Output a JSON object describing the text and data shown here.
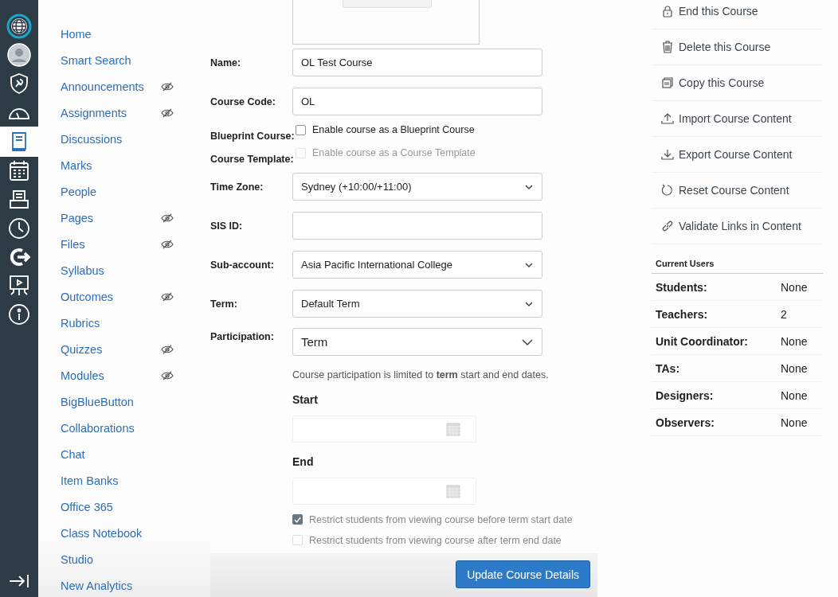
{
  "global_nav": {
    "items": [
      {
        "kind": "logo",
        "selected": false
      },
      {
        "kind": "account",
        "selected": false
      },
      {
        "kind": "admin",
        "selected": false
      },
      {
        "kind": "dashboard",
        "selected": false
      },
      {
        "kind": "courses",
        "selected": true
      },
      {
        "kind": "calendar",
        "selected": false
      },
      {
        "kind": "inbox",
        "selected": false
      },
      {
        "kind": "history",
        "selected": false
      },
      {
        "kind": "commons",
        "selected": false
      },
      {
        "kind": "studio",
        "selected": false
      },
      {
        "kind": "help",
        "selected": false
      }
    ]
  },
  "course_nav": {
    "items": [
      {
        "label": "Home",
        "hidden": false
      },
      {
        "label": "Smart Search",
        "hidden": false
      },
      {
        "label": "Announcements",
        "hidden": true
      },
      {
        "label": "Assignments",
        "hidden": true
      },
      {
        "label": "Discussions",
        "hidden": false
      },
      {
        "label": "Marks",
        "hidden": false
      },
      {
        "label": "People",
        "hidden": false
      },
      {
        "label": "Pages",
        "hidden": true
      },
      {
        "label": "Files",
        "hidden": true
      },
      {
        "label": "Syllabus",
        "hidden": false
      },
      {
        "label": "Outcomes",
        "hidden": true
      },
      {
        "label": "Rubrics",
        "hidden": false
      },
      {
        "label": "Quizzes",
        "hidden": true
      },
      {
        "label": "Modules",
        "hidden": true
      },
      {
        "label": "BigBlueButton",
        "hidden": false
      },
      {
        "label": "Collaborations",
        "hidden": false
      },
      {
        "label": "Chat",
        "hidden": false
      },
      {
        "label": "Item Banks",
        "hidden": false
      },
      {
        "label": "Office 365",
        "hidden": false
      },
      {
        "label": "Class Notebook",
        "hidden": false
      },
      {
        "label": "Studio",
        "hidden": false
      },
      {
        "label": "New Analytics",
        "hidden": false
      }
    ]
  },
  "form": {
    "rows": [
      {
        "kind": "text",
        "label": "Name:",
        "value": "OL Test Course"
      },
      {
        "kind": "text",
        "label": "Course Code:",
        "value": "OL"
      },
      {
        "kind": "checkbox",
        "label": "Blueprint Course:",
        "option": "Enable course as a Blueprint Course",
        "checked": false,
        "disabled": false
      },
      {
        "kind": "checkbox",
        "label": "Course Template:",
        "option": "Enable course as a Course Template",
        "checked": false,
        "disabled": true
      },
      {
        "kind": "select",
        "label": "Time Zone:",
        "value": "Sydney (+10:00/+11:00)"
      },
      {
        "kind": "text",
        "label": "SIS ID:"
      },
      {
        "kind": "select",
        "label": "Sub-account:",
        "value": "Asia Pacific International College"
      },
      {
        "kind": "select",
        "label": "Term:",
        "value": "Default Term"
      }
    ],
    "participation": {
      "label": "Participation:",
      "value": "Term",
      "note": "Course participation is limited to **term** start and end dates.",
      "start_label": "Start",
      "end_label": "End",
      "restrictions": [
        {
          "label": "Restrict students from viewing course before term start date",
          "checked": true
        },
        {
          "label": "Restrict students from viewing course after term end date",
          "checked": false
        }
      ]
    },
    "submit": "Update Course Details"
  },
  "actions": [
    {
      "kind": "lock",
      "label": "End this Course"
    },
    {
      "kind": "trash",
      "label": "Delete this Course"
    },
    {
      "kind": "copy",
      "label": "Copy this Course"
    },
    {
      "kind": "upload",
      "label": "Import Course Content"
    },
    {
      "kind": "download",
      "label": "Export Course Content"
    },
    {
      "kind": "reset",
      "label": "Reset Course Content"
    },
    {
      "kind": "link",
      "label": "Validate Links in Content"
    }
  ],
  "current_users": {
    "title": "Current Users",
    "rows": [
      {
        "role": "Students:",
        "count": "None"
      },
      {
        "role": "Teachers:",
        "count": "2"
      },
      {
        "role": "Unit Coordinator:",
        "count": "None"
      },
      {
        "role": "TAs:",
        "count": "None"
      },
      {
        "role": "Designers:",
        "count": "None"
      },
      {
        "role": "Observers:",
        "count": "None"
      }
    ]
  }
}
